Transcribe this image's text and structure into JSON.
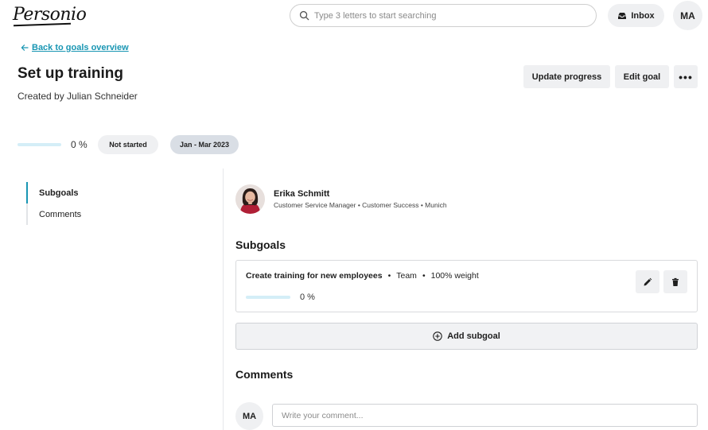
{
  "header": {
    "logo_text": "Personio",
    "search": {
      "placeholder": "Type 3 letters to start searching",
      "icon": "search-icon"
    },
    "inbox_label": "Inbox",
    "user_initials": "MA"
  },
  "goal": {
    "back_link": "Back to goals overview",
    "title": "Set up training",
    "created_by": "Created by Julian Schneider",
    "actions": {
      "update_progress": "Update progress",
      "edit_goal": "Edit goal",
      "more": "•••"
    },
    "progress": {
      "value": 0,
      "label": "0 %"
    },
    "status": "Not started",
    "period": "Jan - Mar 2023"
  },
  "subnav": {
    "items": [
      {
        "label": "Subgoals",
        "active": true
      },
      {
        "label": "Comments",
        "active": false
      }
    ]
  },
  "owner": {
    "name": "Erika Schmitt",
    "meta": "Customer Service Manager • Customer Success • Munich"
  },
  "subgoals": {
    "title": "Subgoals",
    "items": [
      {
        "name": "Create training for new employees",
        "scope": "Team",
        "weight": "100% weight",
        "progress": 0,
        "progress_label": "0 %"
      }
    ],
    "add_label": "Add subgoal"
  },
  "comments": {
    "title": "Comments",
    "user_initials": "MA",
    "placeholder": "Write your comment..."
  },
  "colors": {
    "accent": "#1996b3",
    "progress_track": "#d4eef7",
    "button_bg": "#eff0f2",
    "period_pill_bg": "#d9dee5"
  }
}
